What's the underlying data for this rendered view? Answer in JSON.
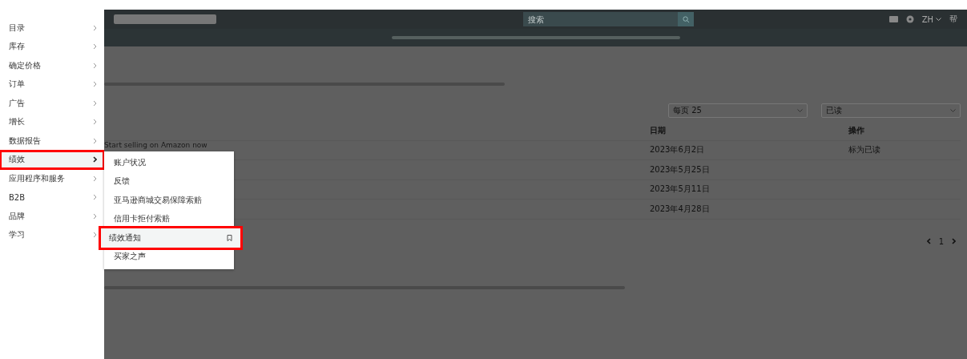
{
  "sidebar": {
    "items": [
      {
        "label": "目录",
        "selected": false,
        "highlighted": false
      },
      {
        "label": "库存",
        "selected": false,
        "highlighted": false
      },
      {
        "label": "确定价格",
        "selected": false,
        "highlighted": false
      },
      {
        "label": "订单",
        "selected": false,
        "highlighted": false
      },
      {
        "label": "广告",
        "selected": false,
        "highlighted": false
      },
      {
        "label": "增长",
        "selected": false,
        "highlighted": false
      },
      {
        "label": "数据报告",
        "selected": false,
        "highlighted": false
      },
      {
        "label": "绩效",
        "selected": true,
        "highlighted": true
      },
      {
        "label": "应用程序和服务",
        "selected": false,
        "highlighted": false
      },
      {
        "label": "B2B",
        "selected": false,
        "highlighted": false
      },
      {
        "label": "品牌",
        "selected": false,
        "highlighted": false
      },
      {
        "label": "学习",
        "selected": false,
        "highlighted": false
      }
    ]
  },
  "submenu": {
    "items": [
      {
        "label": "账户状况",
        "highlighted": false,
        "bookmark": false
      },
      {
        "label": "反馈",
        "highlighted": false,
        "bookmark": false
      },
      {
        "label": "亚马逊商城交易保障索赔",
        "highlighted": false,
        "bookmark": false
      },
      {
        "label": "信用卡拒付索赔",
        "highlighted": false,
        "bookmark": false
      },
      {
        "label": "绩效通知",
        "highlighted": true,
        "bookmark": true
      },
      {
        "label": "买家之声",
        "highlighted": false,
        "bookmark": false
      }
    ]
  },
  "header": {
    "search": {
      "placeholder": "搜索"
    },
    "language": "ZH",
    "help": "帮"
  },
  "content": {
    "subtitle": "Start selling on Amazon now",
    "filters": [
      "每页 25",
      "已读"
    ],
    "table": {
      "columns": [
        "日期",
        "操作"
      ],
      "rows": [
        [
          "2023年6月2日",
          "标为已读"
        ],
        [
          "2023年5月25日",
          ""
        ],
        [
          "2023年5月11日",
          ""
        ],
        [
          "2023年4月28日",
          ""
        ]
      ]
    },
    "pagination": {
      "page": "1"
    }
  }
}
